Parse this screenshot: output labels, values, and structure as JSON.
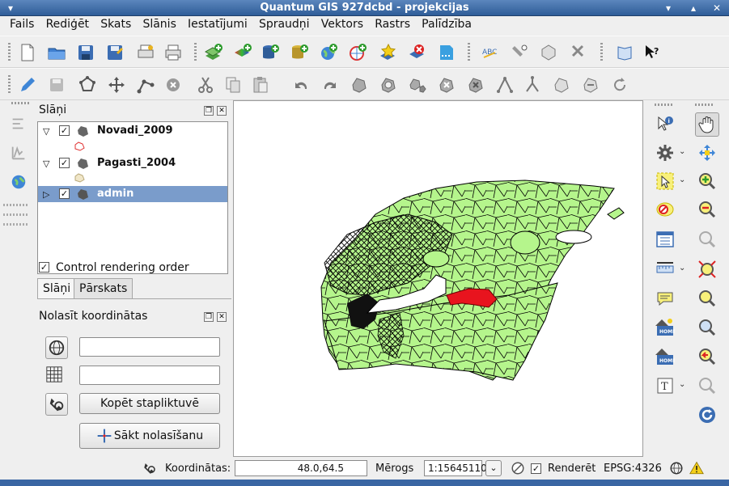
{
  "window": {
    "title": "Quantum GIS 927dcbd - projekcijas",
    "menu_icon": "chevron-down-icon",
    "controls": [
      "minimize",
      "maximize",
      "close"
    ]
  },
  "menubar": {
    "items": [
      {
        "label": "Fails"
      },
      {
        "label": "Rediģēt"
      },
      {
        "label": "Skats"
      },
      {
        "label": "Slānis"
      },
      {
        "label": "Iestatījumi"
      },
      {
        "label": "Spraudņi"
      },
      {
        "label": "Vektors"
      },
      {
        "label": "Rastrs"
      },
      {
        "label": "Palīdzība"
      }
    ]
  },
  "layers_panel": {
    "title": "Slāņi",
    "layers": [
      {
        "name": "Novadi_2009",
        "checked": true,
        "expanded": true,
        "swatch_color": "#ffffff",
        "swatch_border": "#e03030"
      },
      {
        "name": "Pagasti_2004",
        "checked": true,
        "expanded": true,
        "swatch_color": "#f0e6c8",
        "swatch_border": "#b8a878"
      },
      {
        "name": "admin",
        "checked": true,
        "expanded": false,
        "selected": true
      }
    ],
    "control_rendering_order": {
      "label": "Control rendering order",
      "checked": true
    },
    "tabs": [
      {
        "label": "Slāņi",
        "active": true
      },
      {
        "label": "Pārskats",
        "active": false
      }
    ]
  },
  "coords_panel": {
    "title": "Nolasīt koordinātas",
    "field1_value": "",
    "field2_value": "",
    "copy_button": "Kopēt stapliktuvē",
    "start_button": "Sākt nolasīšanu"
  },
  "statusbar": {
    "coords_label": "Koordinātas:",
    "coords_value": "48.0,64.5",
    "scale_label": "Mērogs",
    "scale_value": "1:15645110",
    "render_label": "Renderēt",
    "render_checked": true,
    "crs_label": "EPSG:4326"
  },
  "map": {
    "background": "#ffffff",
    "fill_color": "#b5f58c",
    "boundary_color": "#000000",
    "highlight_color": "#e8141e"
  }
}
